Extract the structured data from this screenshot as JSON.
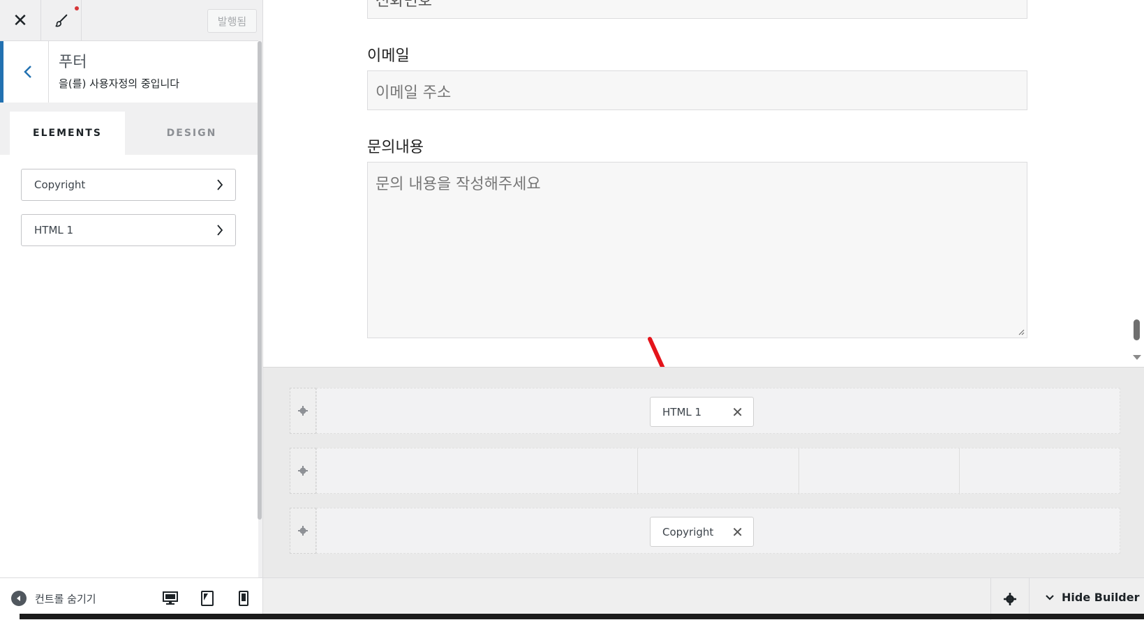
{
  "topbar": {
    "close_glyph": "✕",
    "publish_label": "발행됨"
  },
  "section": {
    "title": "푸터",
    "subtitle": "을(를) 사용자정의 중입니다"
  },
  "tabs": [
    {
      "label": "ELEMENTS",
      "active": true
    },
    {
      "label": "DESIGN",
      "active": false
    }
  ],
  "elements": [
    {
      "label": "Copyright"
    },
    {
      "label": "HTML 1"
    }
  ],
  "bottom_bar": {
    "hide_controls_label": "컨트롤 숨기기"
  },
  "preview": {
    "partial_field_label": "전화번호",
    "email_label": "이메일",
    "email_placeholder": "이메일 주소",
    "message_label": "문의내용",
    "message_placeholder": "문의 내용을 작성해주세요"
  },
  "builder": {
    "rows": [
      {
        "chip": "HTML 1",
        "chip_close": "✕"
      },
      {
        "chip": null
      },
      {
        "chip": "Copyright",
        "chip_close": "✕"
      }
    ],
    "hide_builder_label": "Hide Builder"
  },
  "colors": {
    "accent": "#2271b1",
    "notification_dot": "#d63638",
    "annotation_arrow": "#e4141b"
  }
}
